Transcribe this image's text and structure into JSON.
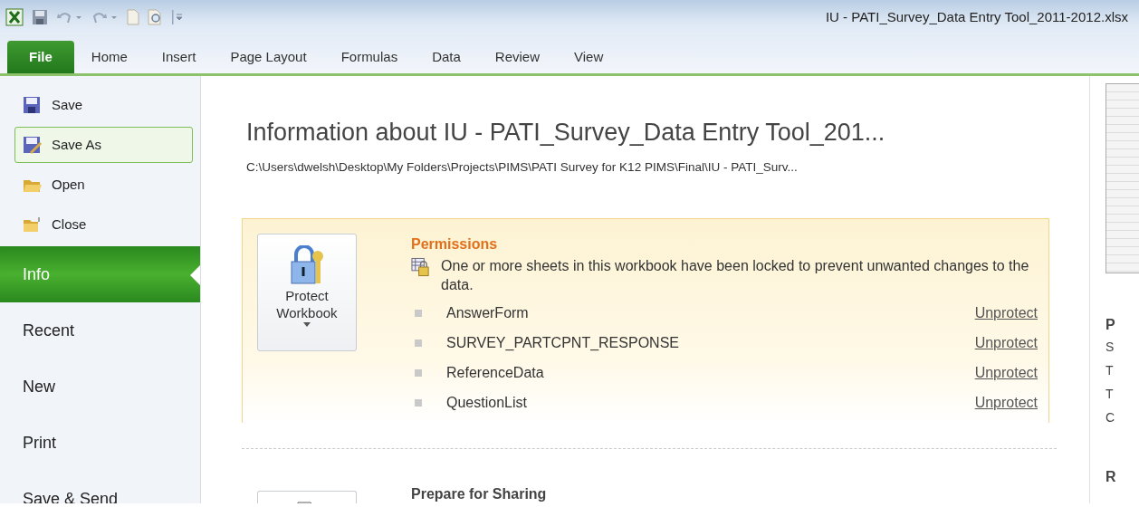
{
  "window": {
    "title": "IU - PATI_Survey_Data Entry Tool_2011-2012.xlsx"
  },
  "ribbon_tabs": [
    {
      "label": "File",
      "selected": true
    },
    {
      "label": "Home",
      "selected": false
    },
    {
      "label": "Insert",
      "selected": false
    },
    {
      "label": "Page Layout",
      "selected": false
    },
    {
      "label": "Formulas",
      "selected": false
    },
    {
      "label": "Data",
      "selected": false
    },
    {
      "label": "Review",
      "selected": false
    },
    {
      "label": "View",
      "selected": false
    }
  ],
  "sidebar": {
    "items": [
      {
        "label": "Save",
        "kind": "command",
        "selected": false,
        "hovered": false
      },
      {
        "label": "Save As",
        "kind": "command",
        "selected": false,
        "hovered": true
      },
      {
        "label": "Open",
        "kind": "command",
        "selected": false,
        "hovered": false
      },
      {
        "label": "Close",
        "kind": "command",
        "selected": false,
        "hovered": false
      },
      {
        "label": "Info",
        "kind": "section",
        "selected": true,
        "hovered": false
      },
      {
        "label": "Recent",
        "kind": "section",
        "selected": false,
        "hovered": false
      },
      {
        "label": "New",
        "kind": "section",
        "selected": false,
        "hovered": false
      },
      {
        "label": "Print",
        "kind": "section",
        "selected": false,
        "hovered": false
      },
      {
        "label": "Save & Send",
        "kind": "section",
        "selected": false,
        "hovered": false
      }
    ]
  },
  "info": {
    "title": "Information about IU - PATI_Survey_Data Entry Tool_201...",
    "path": "C:\\Users\\dwelsh\\Desktop\\My Folders\\Projects\\PIMS\\PATI Survey for K12 PIMS\\Final\\IU - PATI_Surv...",
    "permissions": {
      "button": "Protect Workbook",
      "title": "Permissions",
      "message": "One or more sheets in this workbook have been locked to prevent unwanted changes to the data.",
      "sheets": [
        {
          "name": "AnswerForm",
          "action": "Unprotect"
        },
        {
          "name": "SURVEY_PARTCPNT_RESPONSE",
          "action": "Unprotect"
        },
        {
          "name": "ReferenceData",
          "action": "Unprotect"
        },
        {
          "name": "QuestionList",
          "action": "Unprotect"
        }
      ]
    },
    "prepare": {
      "title": "Prepare for Sharing"
    }
  },
  "right_panel": {
    "lines": [
      {
        "text": "P",
        "kind": "heading"
      },
      {
        "text": "S",
        "kind": "line"
      },
      {
        "text": "T",
        "kind": "line"
      },
      {
        "text": "T",
        "kind": "line"
      },
      {
        "text": "C",
        "kind": "line"
      },
      {
        "text": "R",
        "kind": "heading"
      }
    ]
  }
}
